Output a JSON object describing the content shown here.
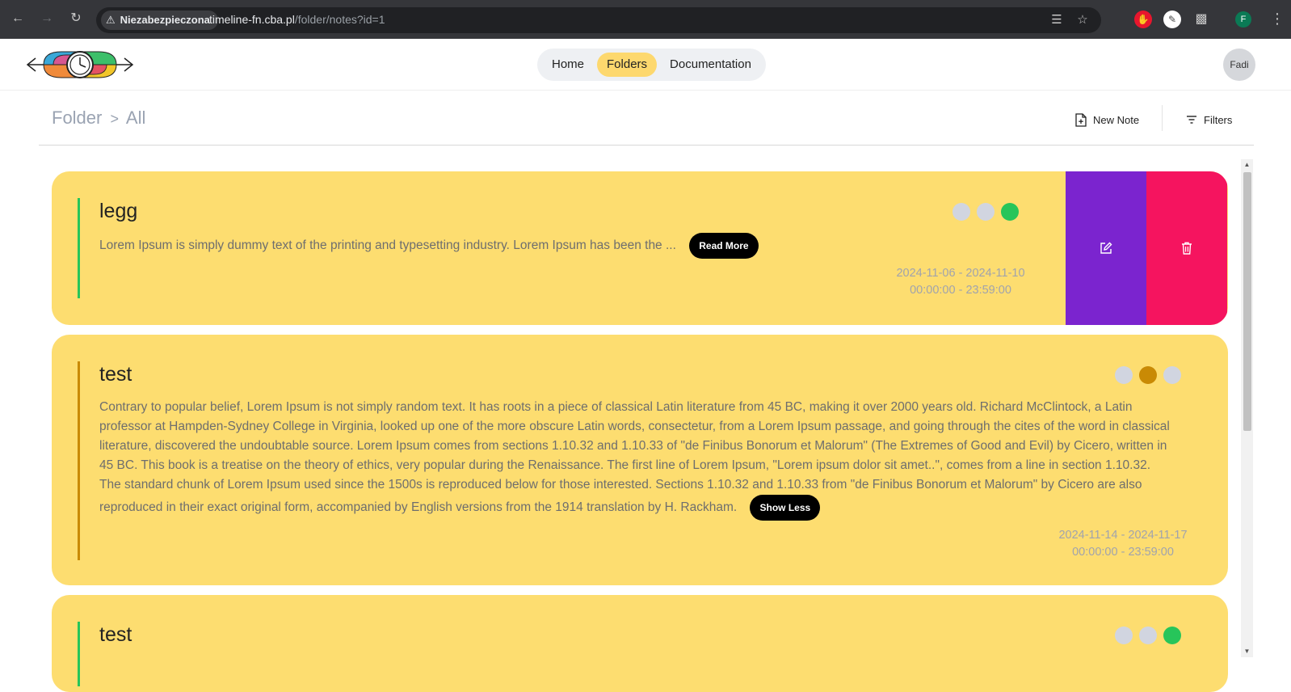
{
  "browser": {
    "security_label": "Niezabezpieczona",
    "url_host": "timeline-fn.cba.pl",
    "url_path": "/folder/notes?id=1",
    "profile_initial": "F"
  },
  "header": {
    "nav": [
      "Home",
      "Folders",
      "Documentation"
    ],
    "active_nav": "Folders",
    "avatar_label": "Fadi"
  },
  "toolbar": {
    "breadcrumb_root": "Folder",
    "breadcrumb_sep": ">",
    "breadcrumb_current": "All",
    "new_note_label": "New Note",
    "filters_label": "Filters"
  },
  "notes": [
    {
      "title": "legg",
      "body": "Lorem Ipsum is simply dummy text of the printing and typesetting industry. Lorem Ipsum has been the ...",
      "button_label": "Read More",
      "date_range": "2024-11-06 - 2024-11-10",
      "time_range": "00:00:00 - 23:59:00",
      "accent_color": "#27c55a",
      "status_dots": [
        "#d1d5e0",
        "#d1d5e0",
        "#27c55a"
      ],
      "actions": [
        "edit",
        "delete"
      ]
    },
    {
      "title": "test",
      "body": "Contrary to popular belief, Lorem Ipsum is not simply random text. It has roots in a piece of classical Latin literature from 45 BC, making it over 2000 years old. Richard McClintock, a Latin professor at Hampden-Sydney College in Virginia, looked up one of the more obscure Latin words, consectetur, from a Lorem Ipsum passage, and going through the cites of the word in classical literature, discovered the undoubtable source. Lorem Ipsum comes from sections 1.10.32 and 1.10.33 of \"de Finibus Bonorum et Malorum\" (The Extremes of Good and Evil) by Cicero, written in 45 BC. This book is a treatise on the theory of ethics, very popular during the Renaissance. The first line of Lorem Ipsum, \"Lorem ipsum dolor sit amet..\", comes from a line in section 1.10.32. The standard chunk of Lorem Ipsum used since the 1500s is reproduced below for those interested. Sections 1.10.32 and 1.10.33 from \"de Finibus Bonorum et Malorum\" by Cicero are also reproduced in their exact original form, accompanied by English versions from the 1914 translation by H. Rackham.",
      "button_label": "Show Less",
      "date_range": "2024-11-14 - 2024-11-17",
      "time_range": "00:00:00 - 23:59:00",
      "accent_color": "#c98a05",
      "status_dots": [
        "#d1d5e0",
        "#c98a05",
        "#d1d5e0"
      ]
    },
    {
      "title": "test",
      "accent_color": "#27c55a",
      "status_dots": [
        "#d1d5e0",
        "#d1d5e0",
        "#27c55a"
      ]
    }
  ],
  "colors": {
    "note_bg": "#fddd70",
    "edit_bg": "#7b24cf",
    "delete_bg": "#f5145f",
    "active_tab": "#fdd86e"
  }
}
